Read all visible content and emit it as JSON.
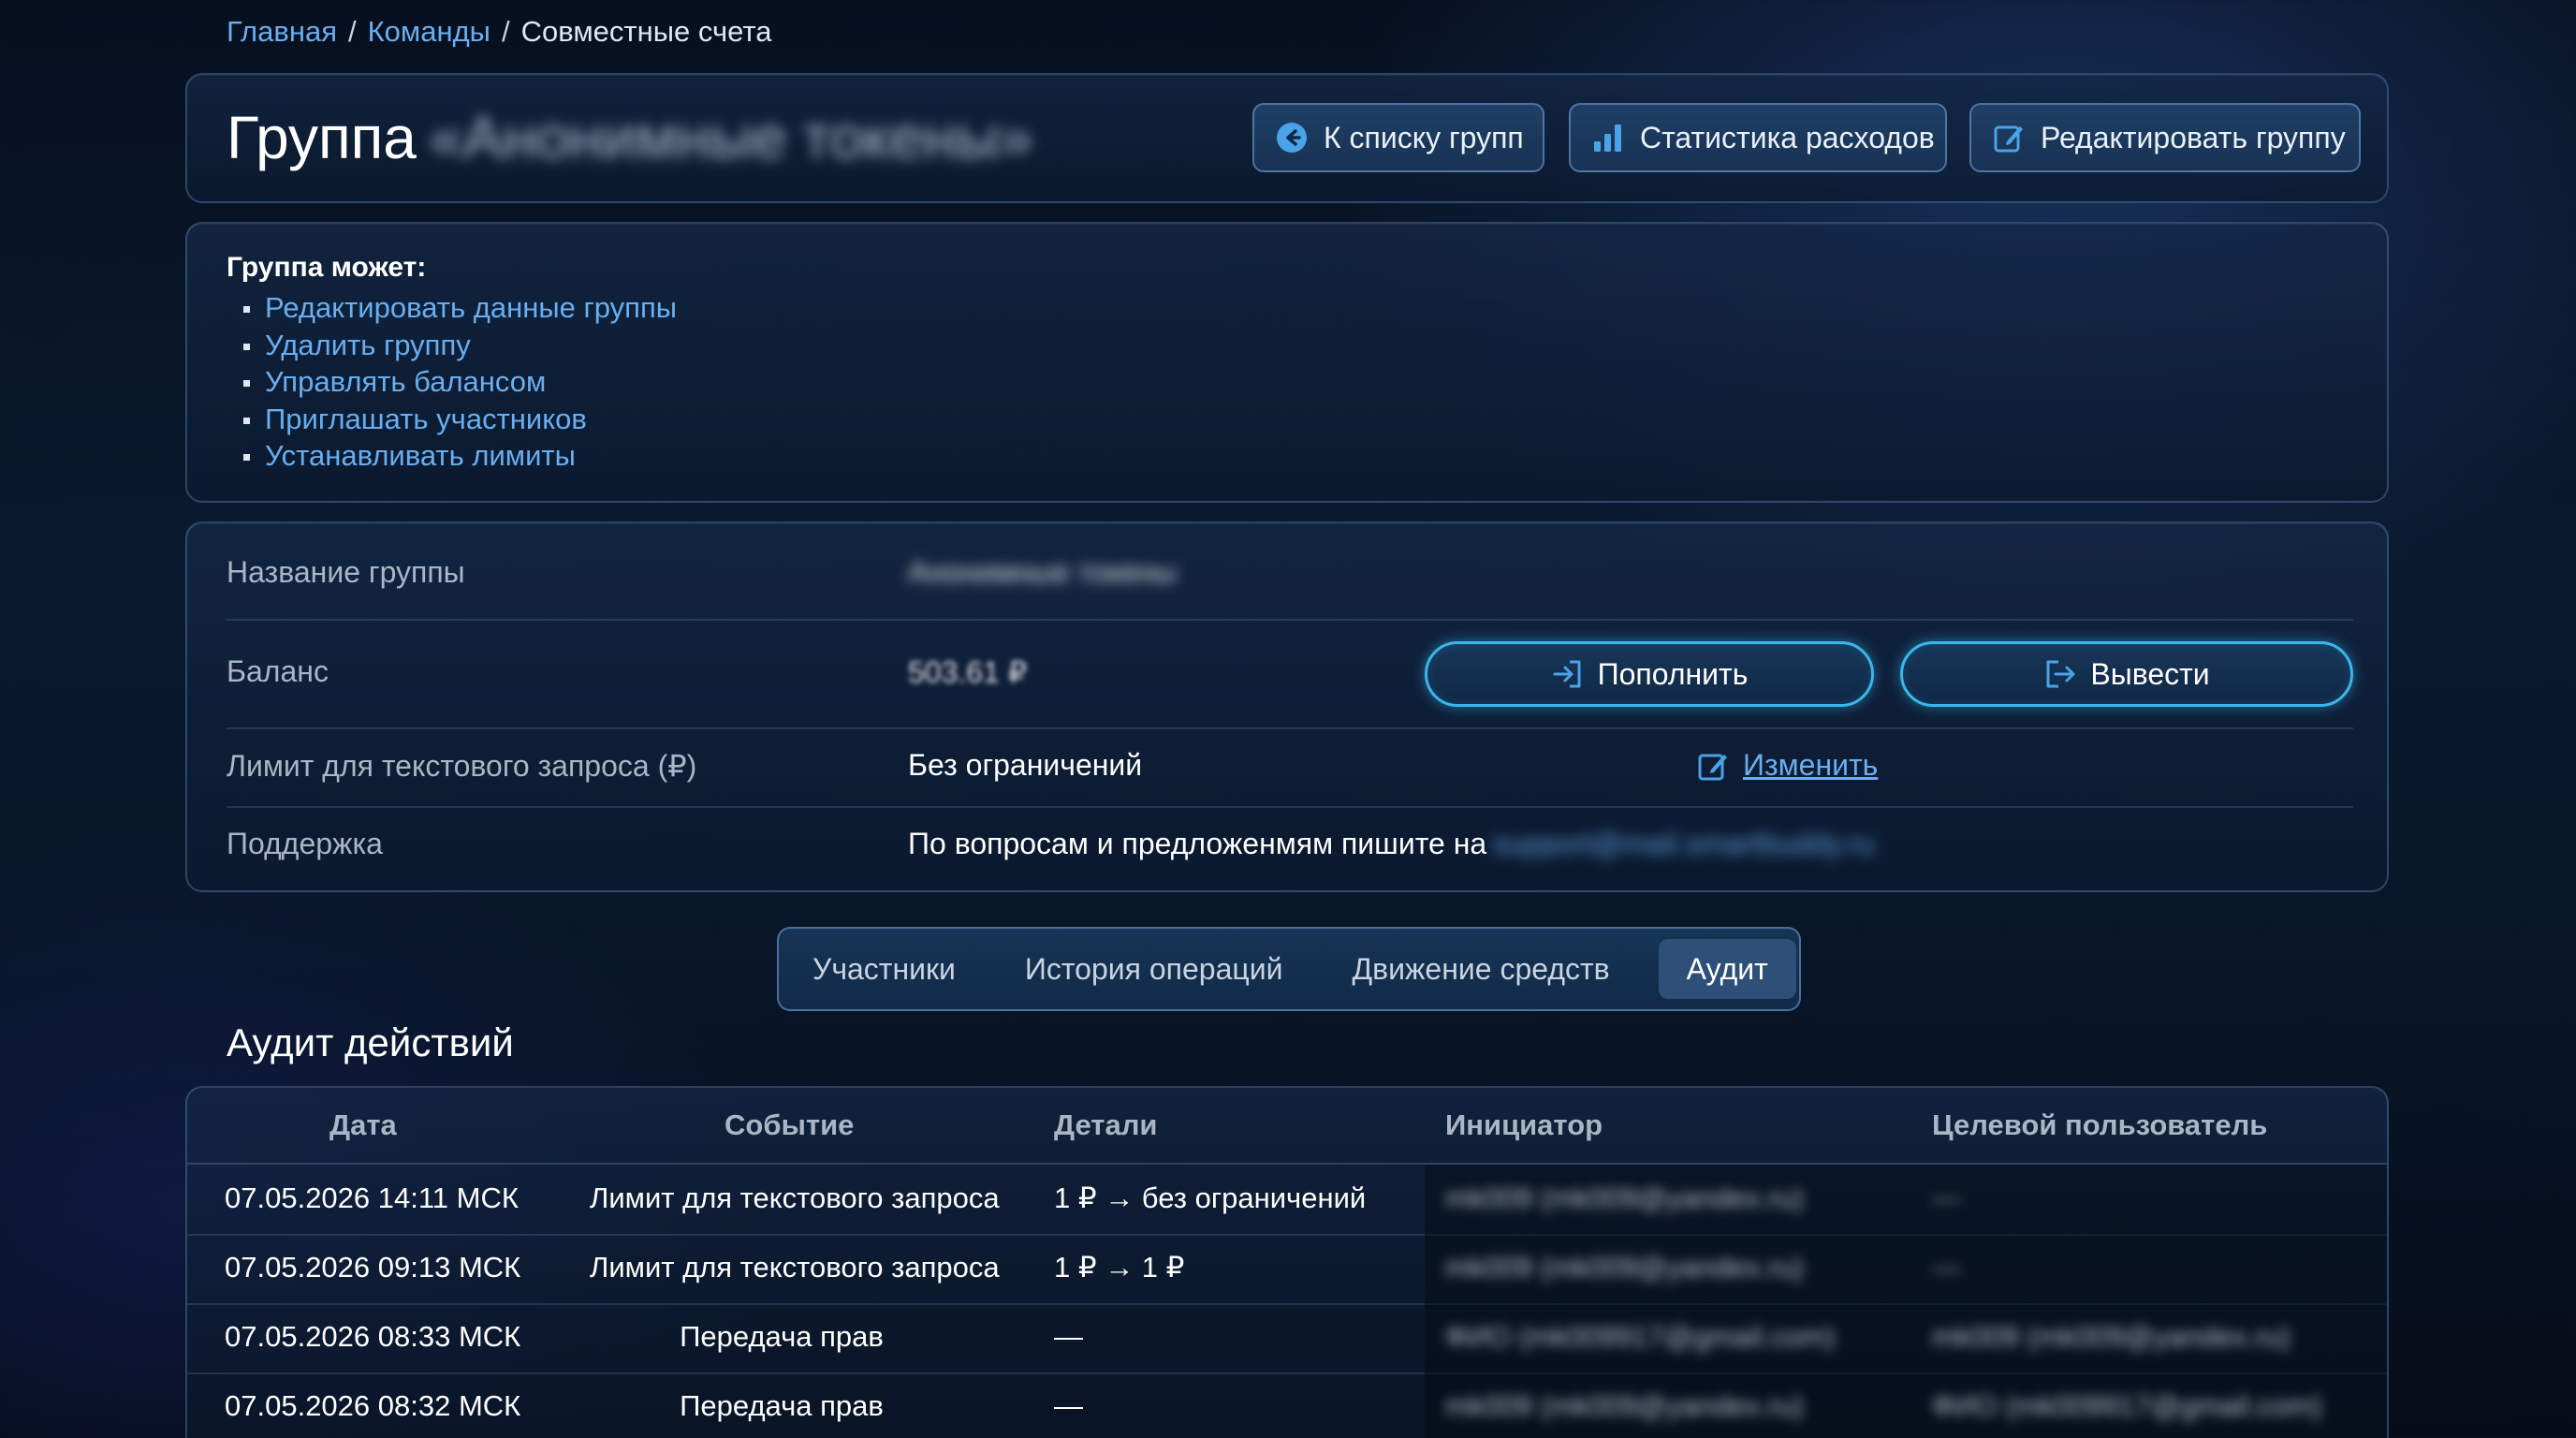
{
  "breadcrumb": {
    "home": "Главная",
    "teams": "Команды",
    "current": "Совместные счета",
    "separator": "/"
  },
  "header": {
    "title_prefix": "Группа",
    "title_hidden": "«Анонимные токены»",
    "btn_back": "К списку групп",
    "btn_stats": "Статистика расходов",
    "btn_edit": "Редактировать группу"
  },
  "permissions": {
    "title": "Группа может:",
    "items": [
      "Редактировать данные группы",
      "Удалить группу",
      "Управлять балансом",
      "Приглашать участников",
      "Устанавливать лимиты"
    ]
  },
  "info": {
    "name_label": "Название группы",
    "name_value": "Анонимные токены",
    "balance_label": "Баланс",
    "balance_value": "503.61 ₽",
    "deposit_btn": "Пополнить",
    "withdraw_btn": "Вывести",
    "limit_label": "Лимит для текстового запроса (₽)",
    "limit_value": "Без ограничений",
    "limit_edit": "Изменить",
    "support_label": "Поддержка",
    "support_text": "По вопросам и предложенмям пишите на",
    "support_email": "support@mail.smartbuddy.ru"
  },
  "tabs": {
    "members": "Участники",
    "history": "История операций",
    "funds": "Движение средств",
    "audit": "Аудит",
    "active": "audit"
  },
  "audit": {
    "title": "Аудит действий",
    "columns": {
      "date": "Дата",
      "event": "Событие",
      "details": "Детали",
      "initiator": "Инициатор",
      "target": "Целевой пользователь"
    },
    "rows": [
      {
        "date": "07.05.2026 14:11 МСК",
        "event": "Лимит для текстового запроса",
        "details": "1 ₽ → без ограничений",
        "initiator": "mk009 (mk009@yandex.ru)",
        "target": "—"
      },
      {
        "date": "07.05.2026 09:13 МСК",
        "event": "Лимит для текстового запроса",
        "details": "1 ₽ → 1 ₽",
        "initiator": "mk009 (mk009@yandex.ru)",
        "target": "—"
      },
      {
        "date": "07.05.2026 08:33 МСК",
        "event": "Передача прав",
        "details": "—",
        "initiator": "ФИО (mk009917@gmail.com)",
        "target": "mk009 (mk009@yandex.ru)"
      },
      {
        "date": "07.05.2026 08:32 МСК",
        "event": "Передача прав",
        "details": "—",
        "initiator": "mk009 (mk009@yandex.ru)",
        "target": "ФИО (mk009917@gmail.com)"
      }
    ]
  }
}
